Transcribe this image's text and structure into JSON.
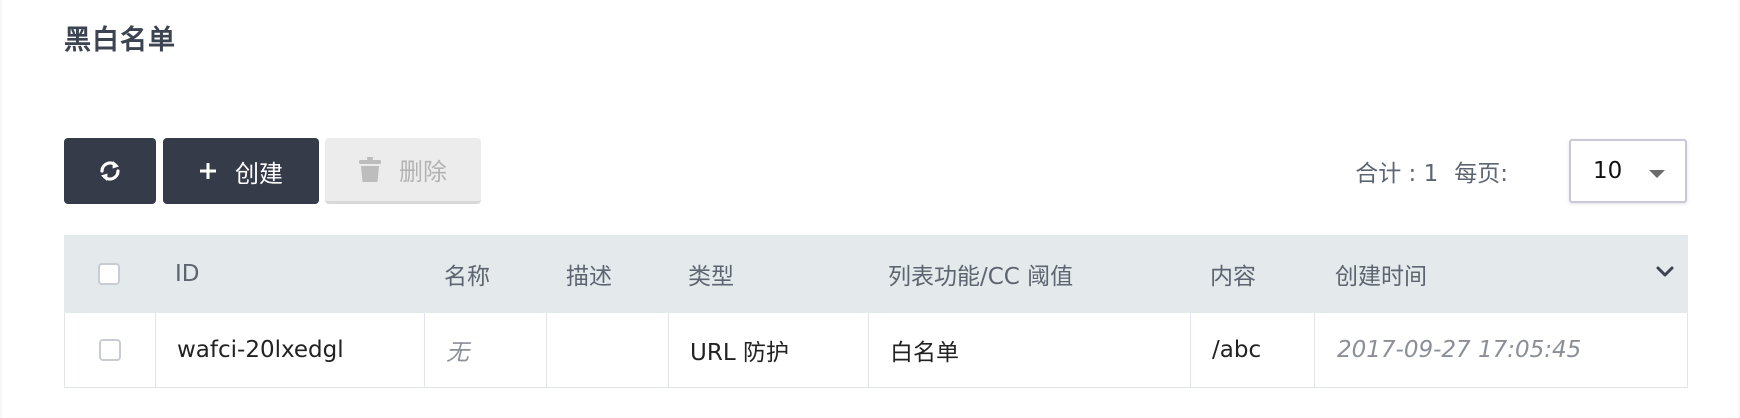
{
  "page": {
    "title": "黑白名单"
  },
  "toolbar": {
    "refresh_icon": "refresh-icon",
    "create_label": "创建",
    "create_icon": "plus-icon",
    "delete_label": "删除",
    "delete_icon": "trash-icon",
    "delete_disabled": true
  },
  "pagination": {
    "total_label": "合计 : 1",
    "per_page_label": "每页:",
    "per_page_value": "10"
  },
  "table": {
    "headers": {
      "id": "ID",
      "name": "名称",
      "description": "描述",
      "type": "类型",
      "list_function": "列表功能/CC 阈值",
      "content": "内容",
      "created_time": "创建时间"
    },
    "rows": [
      {
        "id": "wafci-20lxedgl",
        "name": "无",
        "description": "",
        "type": "URL 防护",
        "list_function": "白名单",
        "content": "/abc",
        "created_time": "2017-09-27 17:05:45"
      }
    ]
  },
  "colors": {
    "primary_button": "#363b4a",
    "header_background": "#e4e9ec",
    "disabled_button": "#ececec"
  }
}
